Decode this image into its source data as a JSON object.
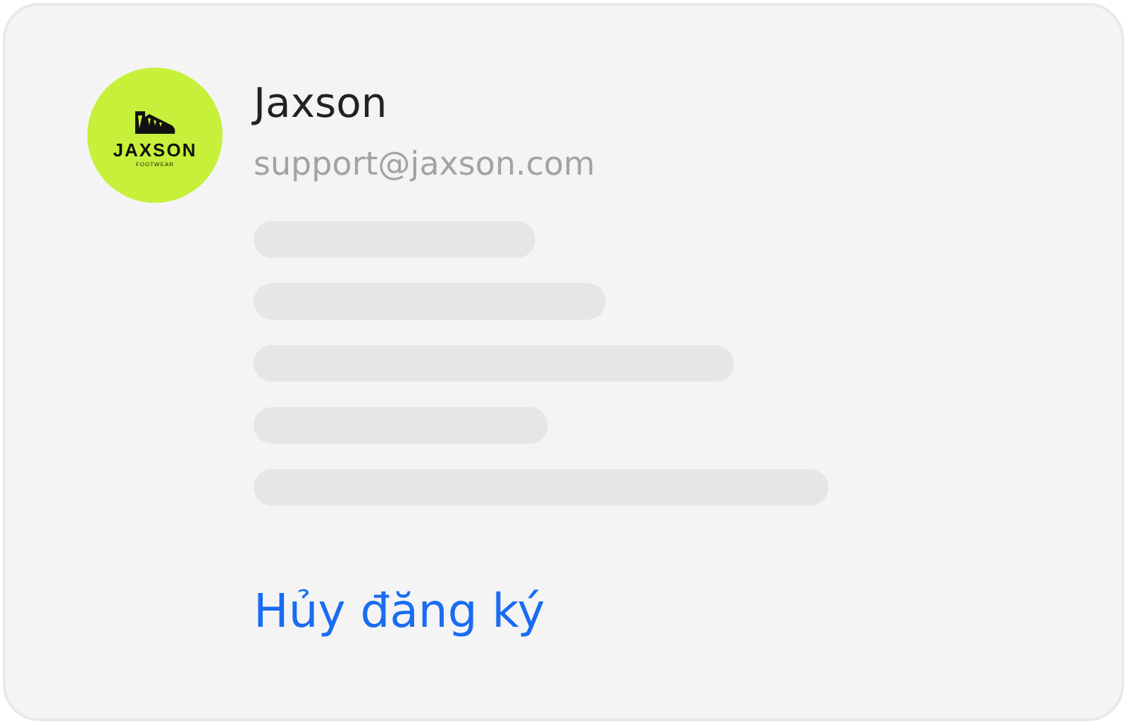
{
  "sender": {
    "logo": {
      "brand": "JAXSON",
      "tagline": "FOOTWEAR"
    },
    "name": "Jaxson",
    "email": "support@jaxson.com"
  },
  "unsubscribe_link": "Hủy đăng ký"
}
